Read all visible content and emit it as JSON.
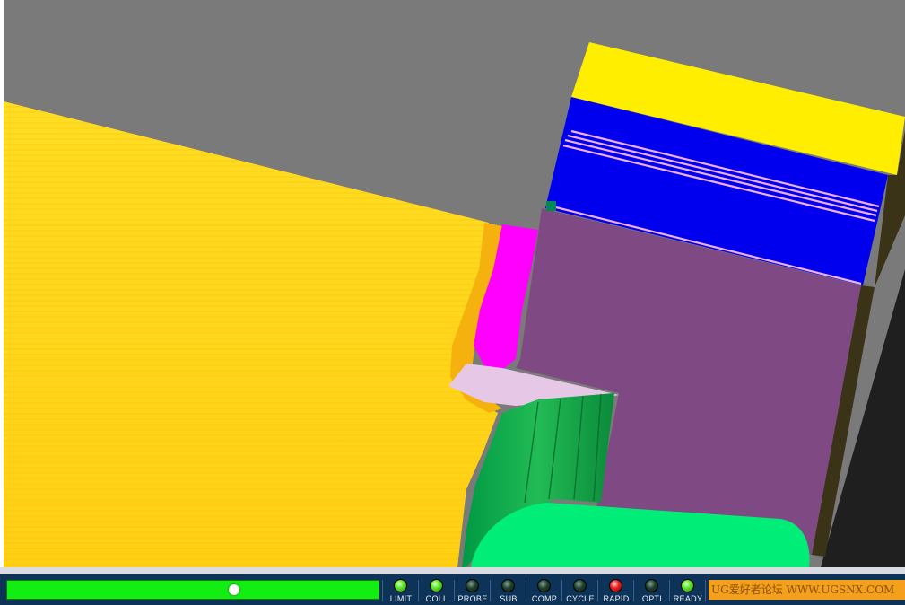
{
  "app": {
    "viewport_name": "machining-simulation-viewport"
  },
  "progress": {
    "value_fraction": 0.61
  },
  "indicators": [
    {
      "label": "LIMIT",
      "state": "green"
    },
    {
      "label": "COLL",
      "state": "green"
    },
    {
      "label": "PROBE",
      "state": "off"
    },
    {
      "label": "SUB",
      "state": "off"
    },
    {
      "label": "COMP",
      "state": "off"
    },
    {
      "label": "CYCLE",
      "state": "off"
    },
    {
      "label": "RAPID",
      "state": "red"
    },
    {
      "label": "OPTI",
      "state": "off"
    },
    {
      "label": "READY",
      "state": "green"
    }
  ],
  "watermark": {
    "text": "UG爱好者论坛 WWW.UGSNX.COM"
  },
  "colors": {
    "workpiece": "#ffd21a",
    "cut_region": "#ff00ff",
    "tool_holder": "#7f4a83",
    "insert_clamp": "#0000ee",
    "holder_top": "#ffee00",
    "toolpath": "#f0b0f0",
    "tool_tip": "#00ee77",
    "background": "#7a7a7a",
    "status_bar": "#0e3358",
    "progress": "#12ee12"
  }
}
